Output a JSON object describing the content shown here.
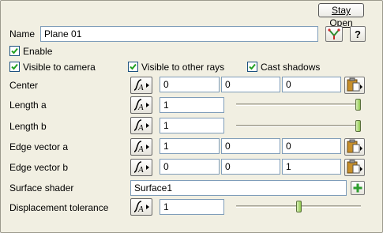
{
  "header": {
    "stay_open_label": "Stay Open"
  },
  "name": {
    "label": "Name",
    "value": "Plane 01"
  },
  "enable": {
    "label": "Enable",
    "checked": true
  },
  "visibility": {
    "camera": {
      "label": "Visible to camera",
      "checked": true
    },
    "rays": {
      "label": "Visible to other rays",
      "checked": true
    },
    "shadows": {
      "label": "Cast shadows",
      "checked": true
    }
  },
  "center": {
    "label": "Center",
    "values": [
      "0",
      "0",
      "0"
    ]
  },
  "length_a": {
    "label": "Length a",
    "value": "1",
    "slider_fraction": 1.0
  },
  "length_b": {
    "label": "Length b",
    "value": "1",
    "slider_fraction": 1.0
  },
  "edge_a": {
    "label": "Edge vector a",
    "values": [
      "1",
      "0",
      "0"
    ]
  },
  "edge_b": {
    "label": "Edge vector b",
    "values": [
      "0",
      "0",
      "1"
    ]
  },
  "shader": {
    "label": "Surface shader",
    "value": "Surface1"
  },
  "displacement": {
    "label": "Displacement tolerance",
    "value": "1",
    "slider_fraction": 0.5
  },
  "icons": {
    "curve": "curve-editor-icon",
    "paste": "paste-icon",
    "pick": "pick-object-icon",
    "help": "help-icon",
    "add": "add-icon"
  }
}
